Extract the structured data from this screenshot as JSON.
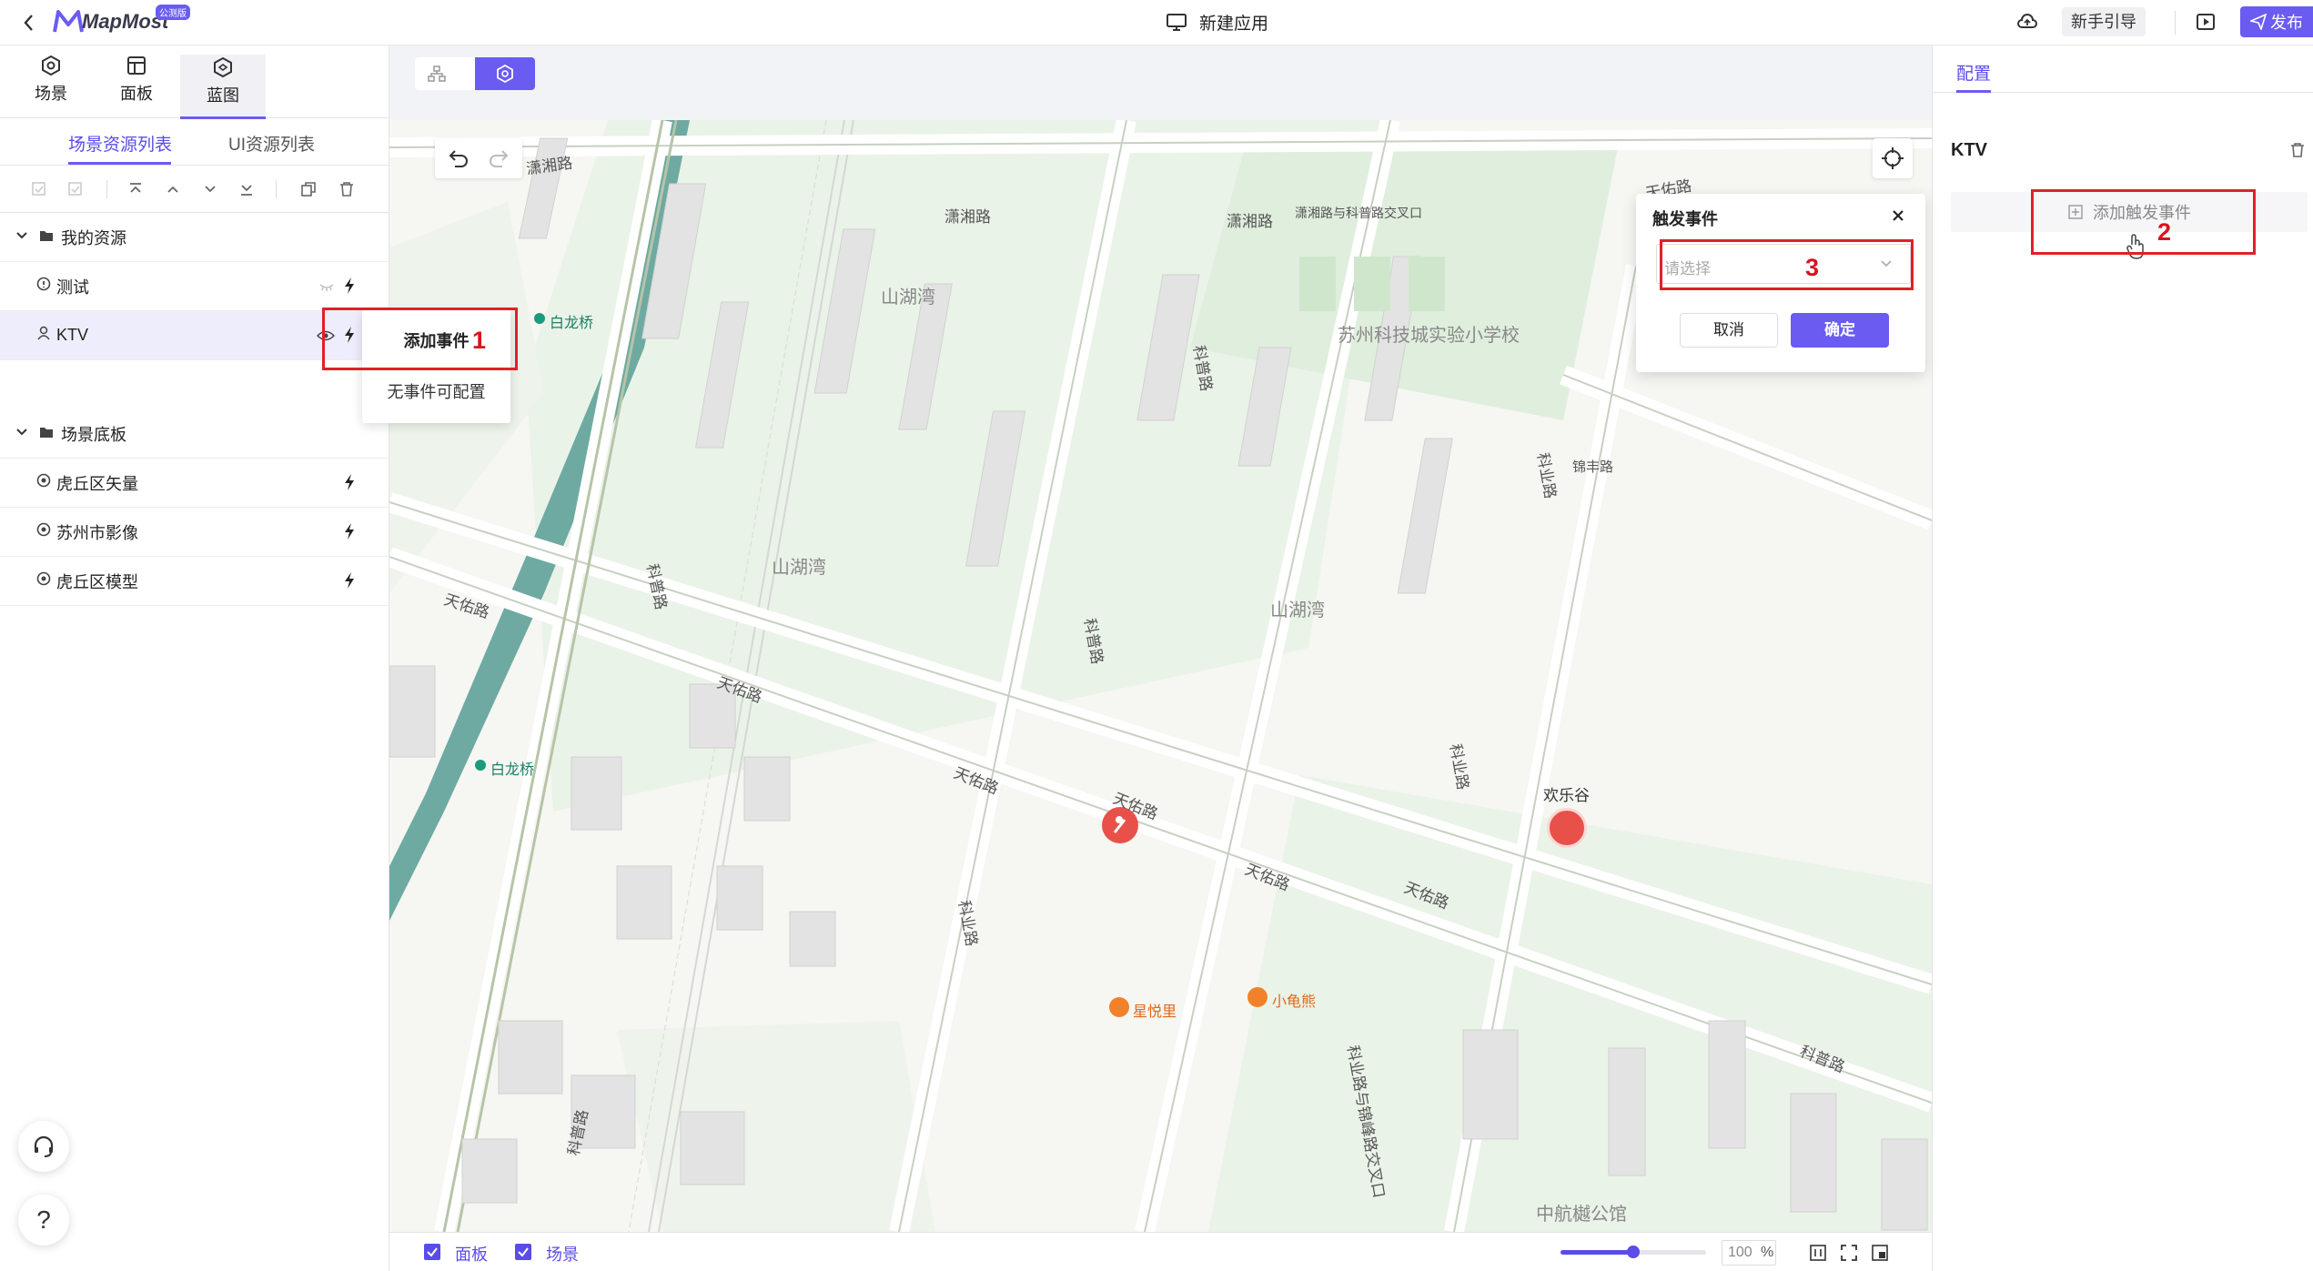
{
  "app": {
    "logo_text": "MapMost",
    "logo_badge": "公测版",
    "title": "新建应用"
  },
  "topbar": {
    "guide_label": "新手引导",
    "publish_label": "发布"
  },
  "left_tabs": [
    {
      "label": "场景",
      "icon": "scene-icon"
    },
    {
      "label": "面板",
      "icon": "panel-icon"
    },
    {
      "label": "蓝图",
      "icon": "blueprint-icon",
      "active": true
    }
  ],
  "resource_tabs": [
    {
      "label": "场景资源列表",
      "active": true
    },
    {
      "label": "UI资源列表",
      "active": false
    }
  ],
  "tree": {
    "group1": "我的资源",
    "group1_items": [
      "测试",
      "KTV"
    ],
    "group2": "场景底板",
    "group2_items": [
      "虎丘区矢量",
      "苏州市影像",
      "虎丘区模型"
    ]
  },
  "context_menu": {
    "add_event": "添加事件",
    "no_event": "无事件可配置"
  },
  "trigger_dialog": {
    "title": "触发事件",
    "placeholder": "请选择",
    "cancel": "取消",
    "confirm": "确定"
  },
  "right_panel": {
    "tab": "配置",
    "object_name": "KTV",
    "add_trigger_label": "添加触发事件"
  },
  "annotations": [
    "1",
    "2",
    "3"
  ],
  "map": {
    "roads": [
      "潇湘路",
      "潇湘路",
      "潇湘路",
      "潇湘路与科普路交叉口",
      "天佑路",
      "天佑路",
      "天佑路",
      "天佑路",
      "天佑路",
      "天佑路",
      "天佑路",
      "科普路",
      "科普路",
      "科普路",
      "科普路",
      "科普路",
      "科业路",
      "科业路",
      "科业路",
      "科业路与锦峰路交叉口",
      "锦丰路"
    ],
    "areas": [
      "山湖湾",
      "山湖湾",
      "山湖湾",
      "苏州科技城实验小学校",
      "中航樾公馆"
    ],
    "pois": [
      "白龙桥",
      "白龙桥",
      "欢乐谷",
      "星悦里",
      "小龟熊"
    ]
  },
  "bottom": {
    "panel_label": "面板",
    "scene_label": "场景",
    "zoom": "100",
    "zoom_unit": "%",
    "zoom_level": 0.5
  },
  "colors": {
    "accent": "#6a5cf0",
    "annotation": "#e0202a",
    "map_bg": "#f6f6f2"
  }
}
